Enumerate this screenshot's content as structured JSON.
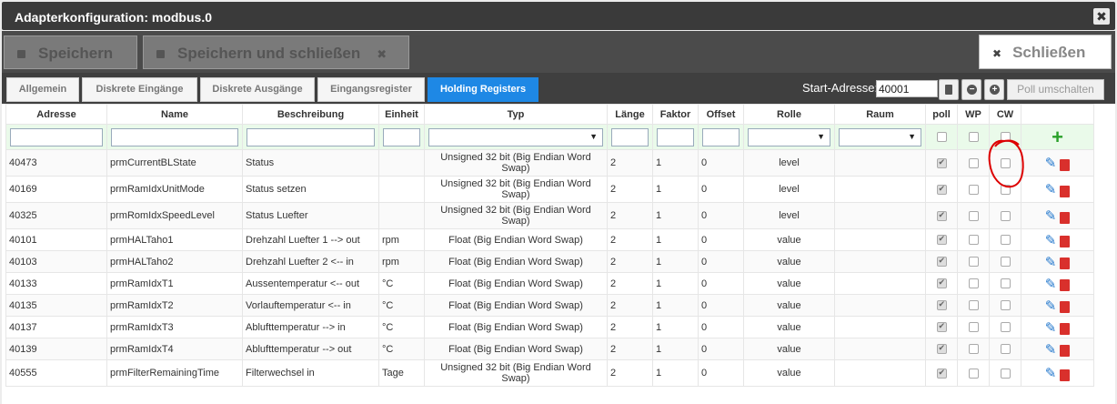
{
  "window": {
    "title": "Adapterkonfiguration: modbus.0",
    "close_glyph": "✖"
  },
  "toolbar": {
    "save_label": "Speichern",
    "save_close_label": "Speichern und schließen",
    "save_close_x": "✖",
    "close_label": "Schließen",
    "close_x": "✖"
  },
  "tabs": [
    "Allgemein",
    "Diskrete Eingänge",
    "Diskrete Ausgänge",
    "Eingangsregister",
    "Holding Registers"
  ],
  "active_tab": "Holding Registers",
  "start": {
    "label": "Start-Adresse:",
    "value": "40001",
    "poll_toggle_label": "Poll umschalten",
    "icons": [
      "trash-icon",
      "minus-circle-icon",
      "plus-circle-icon"
    ]
  },
  "table": {
    "headers": [
      "Adresse",
      "Name",
      "Beschreibung",
      "Einheit",
      "Typ",
      "Länge",
      "Faktor",
      "Offset",
      "Rolle",
      "Raum",
      "poll",
      "WP",
      "CW",
      ""
    ],
    "add_glyph": "+",
    "rows": [
      {
        "adresse": "40473",
        "name": "prmCurrentBLState",
        "beschreibung": "Status",
        "einheit": "",
        "typ": "Unsigned 32 bit (Big Endian Word Swap)",
        "laenge": "2",
        "faktor": "1",
        "offset": "0",
        "rolle": "level",
        "poll": true
      },
      {
        "adresse": "40169",
        "name": "prmRamIdxUnitMode",
        "beschreibung": "Status setzen",
        "einheit": "",
        "typ": "Unsigned 32 bit (Big Endian Word Swap)",
        "laenge": "2",
        "faktor": "1",
        "offset": "0",
        "rolle": "level",
        "poll": true
      },
      {
        "adresse": "40325",
        "name": "prmRomIdxSpeedLevel",
        "beschreibung": "Status Luefter",
        "einheit": "",
        "typ": "Unsigned 32 bit (Big Endian Word Swap)",
        "laenge": "2",
        "faktor": "1",
        "offset": "0",
        "rolle": "level",
        "poll": true
      },
      {
        "adresse": "40101",
        "name": "prmHALTaho1",
        "beschreibung": "Drehzahl Luefter 1 --> out",
        "einheit": "rpm",
        "typ": "Float (Big Endian Word Swap)",
        "laenge": "2",
        "faktor": "1",
        "offset": "0",
        "rolle": "value",
        "poll": true
      },
      {
        "adresse": "40103",
        "name": "prmHALTaho2",
        "beschreibung": "Drehzahl Luefter 2 <-- in",
        "einheit": "rpm",
        "typ": "Float (Big Endian Word Swap)",
        "laenge": "2",
        "faktor": "1",
        "offset": "0",
        "rolle": "value",
        "poll": true
      },
      {
        "adresse": "40133",
        "name": "prmRamIdxT1",
        "beschreibung": "Aussentemperatur <-- out",
        "einheit": "°C",
        "typ": "Float (Big Endian Word Swap)",
        "laenge": "2",
        "faktor": "1",
        "offset": "0",
        "rolle": "value",
        "poll": true
      },
      {
        "adresse": "40135",
        "name": "prmRamIdxT2",
        "beschreibung": "Vorlauftemperatur <-- in",
        "einheit": "°C",
        "typ": "Float (Big Endian Word Swap)",
        "laenge": "2",
        "faktor": "1",
        "offset": "0",
        "rolle": "value",
        "poll": true
      },
      {
        "adresse": "40137",
        "name": "prmRamIdxT3",
        "beschreibung": "Ablufttemperatur --> in",
        "einheit": "°C",
        "typ": "Float (Big Endian Word Swap)",
        "laenge": "2",
        "faktor": "1",
        "offset": "0",
        "rolle": "value",
        "poll": true
      },
      {
        "adresse": "40139",
        "name": "prmRamIdxT4",
        "beschreibung": "Ablufttemperatur --> out",
        "einheit": "°C",
        "typ": "Float (Big Endian Word Swap)",
        "laenge": "2",
        "faktor": "1",
        "offset": "0",
        "rolle": "value",
        "poll": true
      },
      {
        "adresse": "40555",
        "name": "prmFilterRemainingTime",
        "beschreibung": "Filterwechsel in",
        "einheit": "Tage",
        "typ": "Unsigned 32 bit (Big Endian Word Swap)",
        "laenge": "2",
        "faktor": "1",
        "offset": "0",
        "rolle": "value",
        "poll": true
      }
    ]
  },
  "colors": {
    "active_tab": "#1e88e5",
    "add_icon": "#2aa02a",
    "delete_icon": "#d9302c",
    "edit_icon": "#2277cc",
    "annotation": "#dd0000"
  }
}
